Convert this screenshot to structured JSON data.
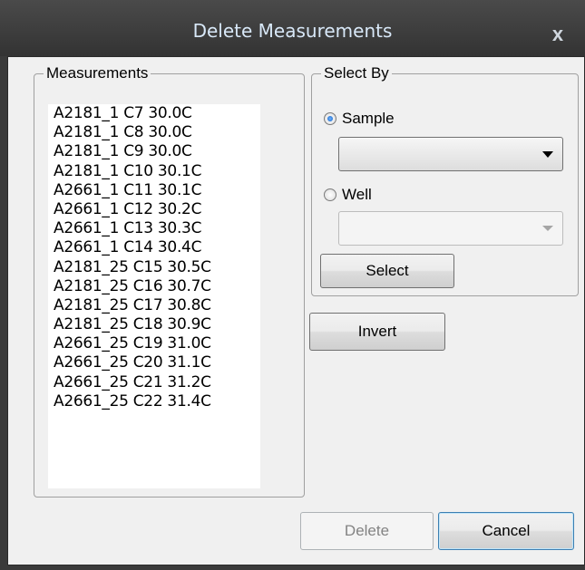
{
  "window": {
    "title": "Delete Measurements",
    "close_glyph": "x"
  },
  "measurements_group": {
    "label": "Measurements",
    "items": [
      "A2181_1 C7 30.0C",
      "A2181_1 C8 30.0C",
      "A2181_1 C9 30.0C",
      "A2181_1 C10 30.1C",
      "A2661_1 C11 30.1C",
      "A2661_1 C12 30.2C",
      "A2661_1 C13 30.3C",
      "A2661_1 C14 30.4C",
      "A2181_25 C15 30.5C",
      "A2181_25 C16 30.7C",
      "A2181_25 C17 30.8C",
      "A2181_25 C18 30.9C",
      "A2661_25 C19 31.0C",
      "A2661_25 C20 31.1C",
      "A2661_25 C21 31.2C",
      "A2661_25 C22 31.4C"
    ]
  },
  "select_by_group": {
    "label": "Select By",
    "sample_label": "Sample",
    "sample_selected": true,
    "sample_value": "",
    "well_label": "Well",
    "well_selected": false,
    "well_value": "",
    "select_button": "Select"
  },
  "invert_button": "Invert",
  "delete_button": "Delete",
  "cancel_button": "Cancel",
  "colors": {
    "title_text": "#d8e8f8",
    "radio_dot": "#1460c4",
    "disabled_text": "#838383"
  }
}
